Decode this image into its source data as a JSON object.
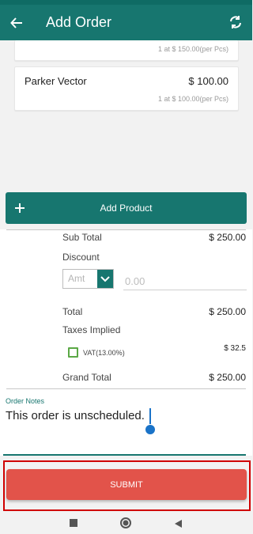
{
  "app_bar": {
    "title": "Add Order",
    "back_icon": "arrow-left-icon",
    "sync_icon": "sync-icon"
  },
  "products": [
    {
      "name": "",
      "price": "",
      "detail": "1 at $ 150.00(per Pcs)"
    },
    {
      "name": "Parker Vector",
      "price": "$ 100.00",
      "detail": "1 at $ 100.00(per Pcs)"
    }
  ],
  "add_product": {
    "label": "Add Product",
    "icon": "plus-icon"
  },
  "summary": {
    "sub_total_label": "Sub Total",
    "sub_total_value": "$ 250.00",
    "discount_label": "Discount",
    "discount_type_placeholder": "Amt",
    "discount_value_placeholder": "0.00",
    "total_label": "Total",
    "total_value": "$ 250.00",
    "taxes_label": "Taxes Implied",
    "vat_label": "VAT(13.00%)",
    "vat_value": "$ 32.5",
    "grand_total_label": "Grand Total",
    "grand_total_value": "$ 250.00"
  },
  "notes": {
    "caption": "Order Notes",
    "value": "This order is unscheduled."
  },
  "submit": {
    "label": "SUBMIT"
  },
  "colors": {
    "primary": "#17766f",
    "submit": "#e2534a",
    "highlight": "#d00000",
    "check": "#5aa845"
  }
}
